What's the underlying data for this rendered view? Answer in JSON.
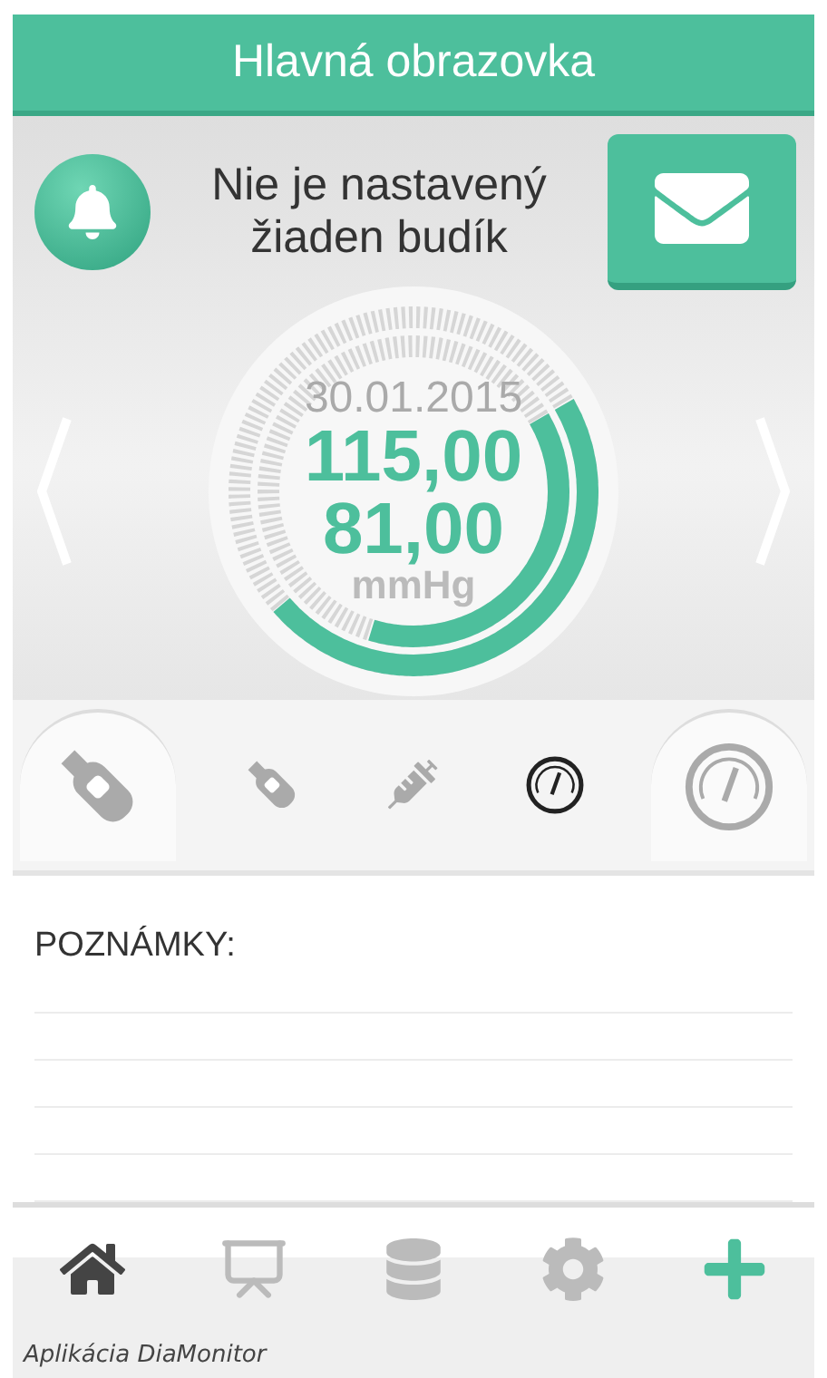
{
  "header": {
    "title": "Hlavná obrazovka"
  },
  "alarm": {
    "message": "Nie je nastavený žiaden budík"
  },
  "reading": {
    "date": "30.01.2015",
    "systolic": "115,00",
    "diastolic": "81,00",
    "unit": "mmHg",
    "outer_ring": {
      "level": 0.47
    },
    "inner_ring": {
      "level": 0.38
    }
  },
  "categories": {
    "previous": {
      "kind": "meter"
    },
    "tabs": [
      {
        "kind": "meter",
        "selected": false
      },
      {
        "kind": "syringe",
        "selected": false
      },
      {
        "kind": "gauge",
        "selected": true
      }
    ],
    "next": {
      "kind": "gauge"
    }
  },
  "notes": {
    "label": "POZNÁMKY:"
  },
  "nav": [
    {
      "kind": "home",
      "selected": true
    },
    {
      "kind": "chart",
      "selected": false
    },
    {
      "kind": "database",
      "selected": false
    },
    {
      "kind": "settings",
      "selected": false
    },
    {
      "kind": "add",
      "selected": false
    }
  ],
  "caption": "Aplikácia DiaMonitor"
}
